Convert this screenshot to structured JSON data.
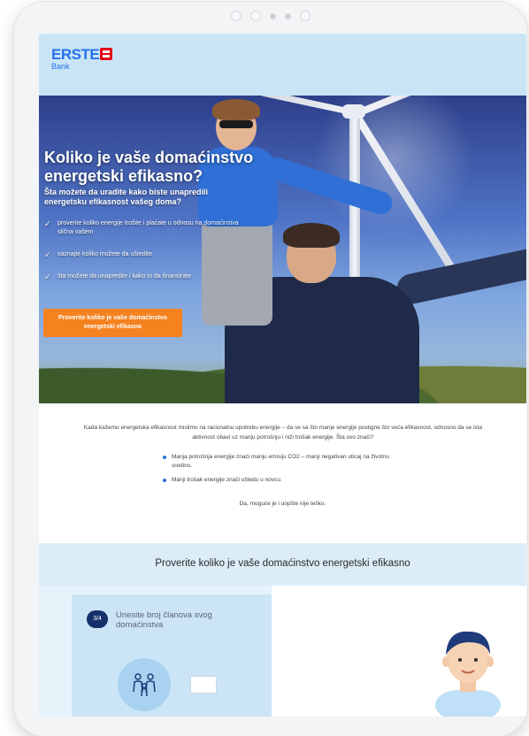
{
  "brand": {
    "logo_text": "ERSTE",
    "logo_sub": "Bank",
    "colors": {
      "primary": "#2870ed",
      "accent_red": "#e30613",
      "cta": "#f5821f",
      "navy": "#15306a"
    }
  },
  "hero": {
    "title": "Koliko je vaše domaćinstvo energetski efikasno?",
    "subtitle": "Šta možete da uradite kako biste unapredili energetsku efikasnost vašeg doma?",
    "checklist": [
      "proverite koliko energije trošite i plaćate u odnosu na domaćinstva slična vašem",
      "saznajte koliko možete da uštedite",
      "šta možete da unapredite i kako to da finansirate"
    ],
    "cta_label": "Proverite koliko je vaše domaćinstvo energetski efikasno"
  },
  "content": {
    "intro": "Kada kažemo energetska efikasnost mislimo na racionalnu upotrebu energije – da se sa što manje energije postigne što veća efikasnost, odnosno da se ista aktivnost obavi uz manju potrošnju i niži trošak energije. Šta ovo znači?",
    "bullets": [
      "Manja potrošnja energije znači manju emisiju CO2 – manji negativan uticaj na životnu sredinu.",
      "Manji trošak energije znači uštedu u novcu."
    ],
    "closing": "Da, moguće je i uopšte nije teško."
  },
  "calculator": {
    "band_title": "Proverite koliko je vaše domaćinstvo energetski efikasno",
    "step_badge": "3/4",
    "question": "Unesite broj članova svog domaćinstva",
    "input_value": ""
  }
}
